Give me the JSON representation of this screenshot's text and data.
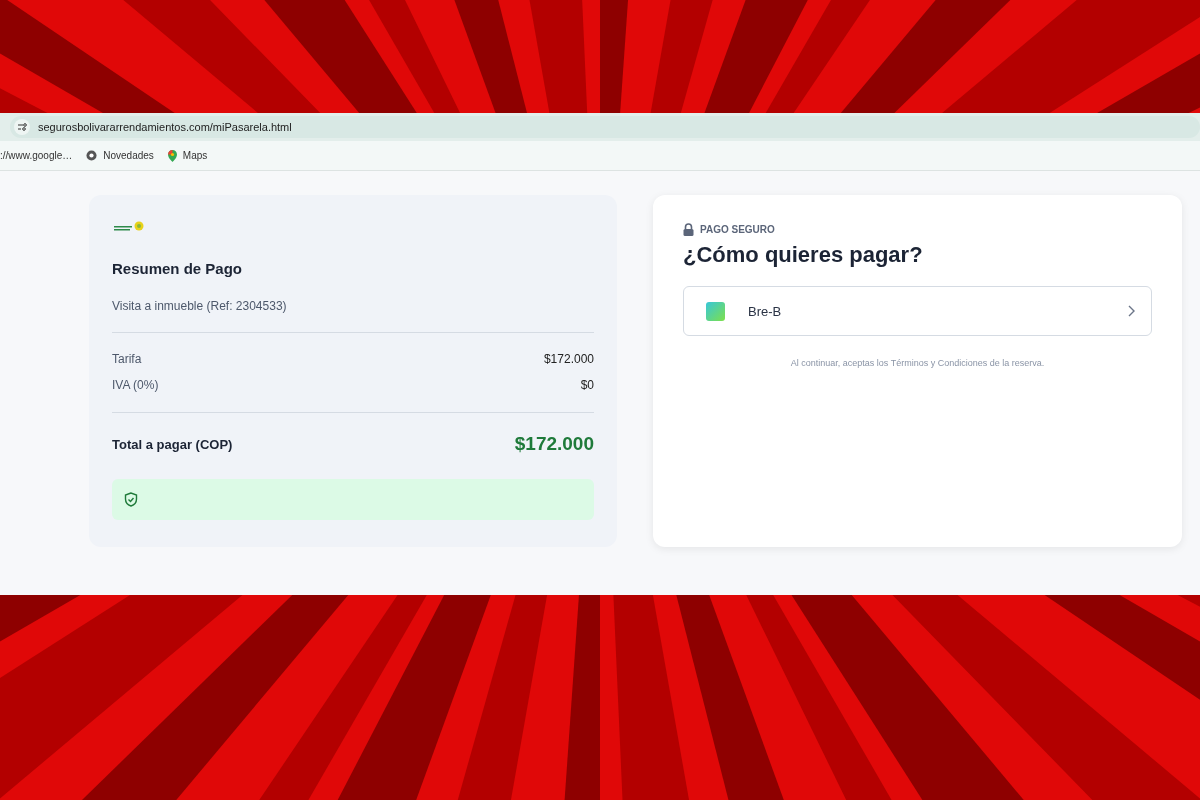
{
  "browser": {
    "url": "segurosbolivararrendamientos.com/miPasarela.html",
    "bookmarks": [
      {
        "kind": "link",
        "label": "://www.google…"
      },
      {
        "kind": "chrome",
        "label": "Novedades"
      },
      {
        "kind": "maps",
        "label": "Maps"
      }
    ]
  },
  "summary": {
    "title": "Resumen de Pago",
    "description": "Visita a inmueble (Ref: 2304533)",
    "lines": [
      {
        "label": "Tarifa",
        "amount": "$172.000"
      },
      {
        "label": "IVA (0%)",
        "amount": "$0"
      }
    ],
    "total_label": "Total a pagar (COP)",
    "total_amount": "$172.000"
  },
  "payment": {
    "badge": "PAGO SEGURO",
    "title": "¿Cómo quieres pagar?",
    "methods": [
      {
        "label": "Bre-B"
      }
    ],
    "terms": "Al continuar, aceptas los Términos y Condiciones de la reserva."
  }
}
